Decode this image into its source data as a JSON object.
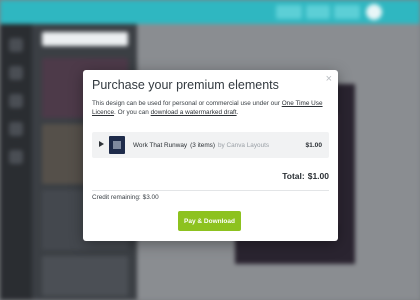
{
  "modal": {
    "title": "Purchase your premium elements",
    "close_symbol": "×",
    "description_before": "This design can be used for personal or commercial use under our ",
    "licence_link": "One Time Use Licence",
    "description_middle": ". Or you can ",
    "draft_link": "download a watermarked draft",
    "description_after": ".",
    "item": {
      "name": "Work That Runway",
      "count": "(3 items)",
      "by": "by Canva Layouts",
      "price": "$1.00",
      "icon": "play-icon"
    },
    "total_label": "Total:",
    "total_value": "$1.00",
    "credit_label": "Credit remaining:",
    "credit_value": "$3.00",
    "pay_button_label": "Pay & Download"
  },
  "colors": {
    "topbar": "#2fb7c1",
    "pay_button": "#8dc21f",
    "overlay": "#7c7f83"
  }
}
